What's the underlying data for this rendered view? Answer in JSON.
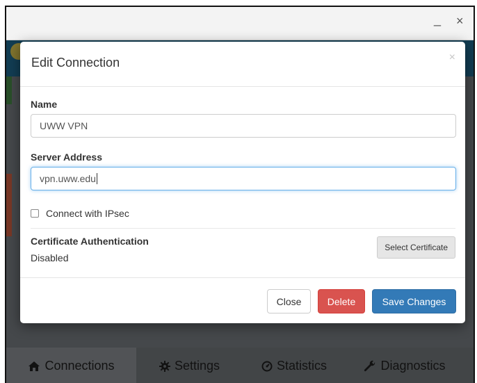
{
  "window": {
    "minimize_glyph": "_",
    "close_glyph": "×"
  },
  "modal": {
    "title": "Edit Connection",
    "close_glyph": "×",
    "name_label": "Name",
    "name_value": "UWW VPN",
    "server_label": "Server Address",
    "server_value": "vpn.uww.edu",
    "ipsec_label": "Connect with IPsec",
    "ipsec_checked": false,
    "cert_label": "Certificate Authentication",
    "cert_status": "Disabled",
    "select_cert_label": "Select Certificate",
    "buttons": {
      "close": "Close",
      "delete": "Delete",
      "save": "Save Changes"
    }
  },
  "tabs": [
    {
      "label": "Connections",
      "icon": "home-icon",
      "active": true
    },
    {
      "label": "Settings",
      "icon": "gear-icon",
      "active": false
    },
    {
      "label": "Statistics",
      "icon": "dashboard-icon",
      "active": false
    },
    {
      "label": "Diagnostics",
      "icon": "wrench-icon",
      "active": false
    }
  ],
  "colors": {
    "primary": "#337ab7",
    "danger": "#d9534f",
    "header": "#1d5f80",
    "focus": "#66afe9"
  }
}
